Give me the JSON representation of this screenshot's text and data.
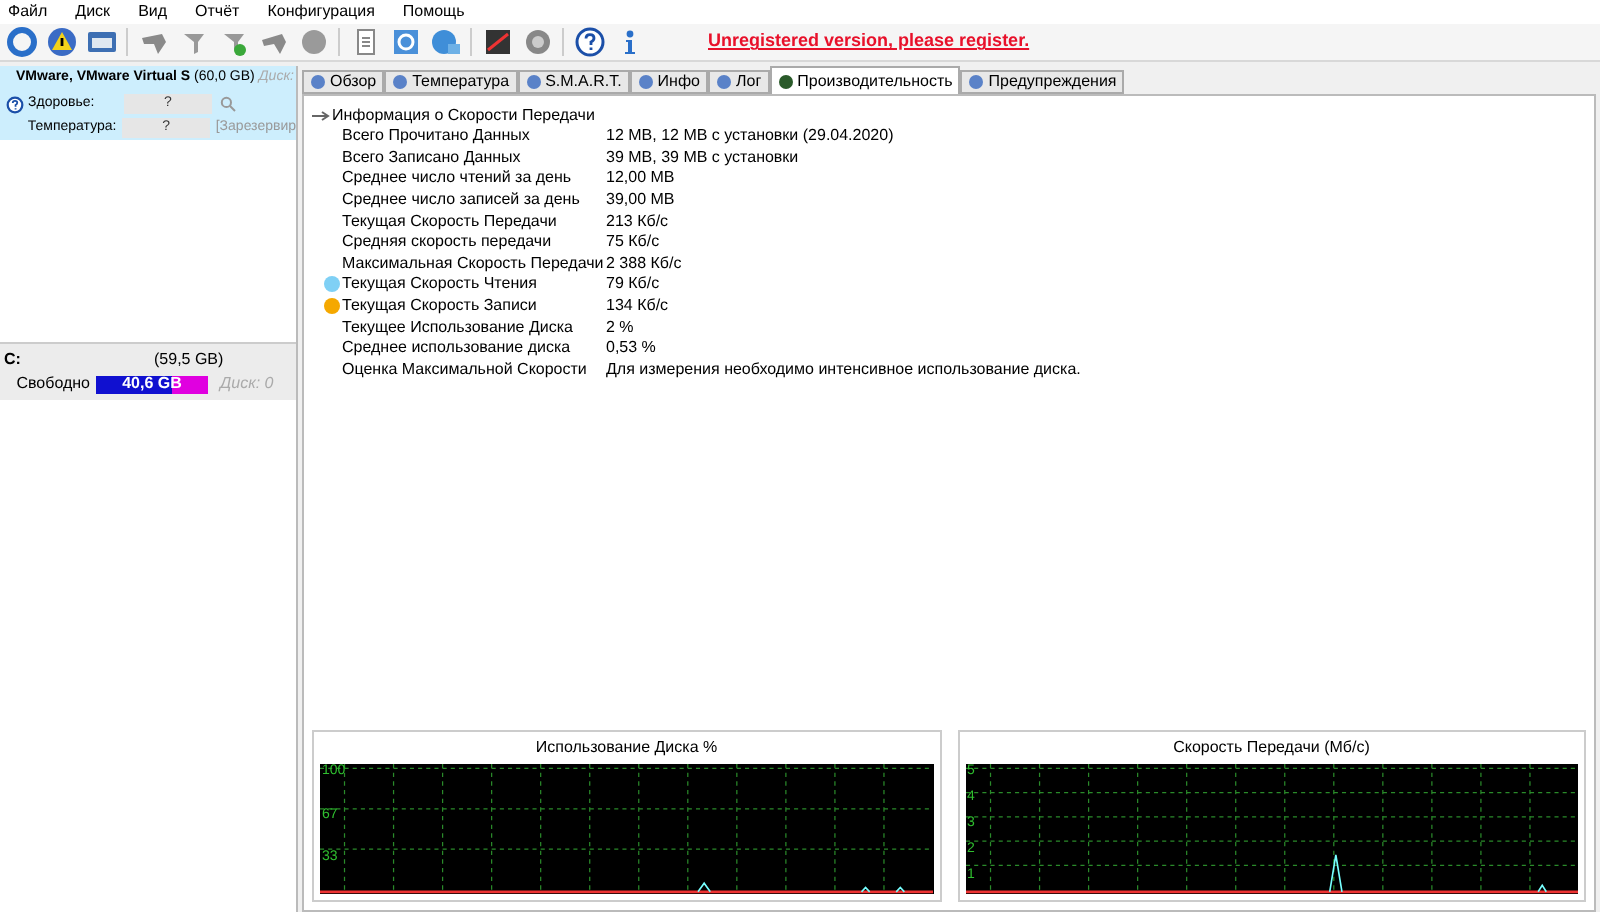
{
  "menu": [
    "Файл",
    "Диск",
    "Вид",
    "Отчёт",
    "Конфигурация",
    "Помощь"
  ],
  "register_link": "Unregistered version, please register.",
  "disk": {
    "title": "VMware, VMware Virtual S",
    "size": "(60,0 GB)",
    "disk_label": "Диск:",
    "selected": true,
    "rows": [
      {
        "label": "Здоровье:",
        "value": "?",
        "extra": "",
        "kind": "health"
      },
      {
        "label": "Температура:",
        "value": "?",
        "extra": "[Зарезервир",
        "kind": "temp"
      }
    ]
  },
  "partition": {
    "name": "C:",
    "size": "(59,5 GB)",
    "free_label": "Свободно",
    "free": "40,6 GB",
    "level": 0.68,
    "disk": "Диск: 0"
  },
  "tabs": [
    {
      "label": "Обзор",
      "selected": false
    },
    {
      "label": "Температура",
      "selected": false
    },
    {
      "label": "S.M.A.R.T.",
      "selected": false
    },
    {
      "label": "Инфо",
      "selected": false
    },
    {
      "label": "Лог",
      "selected": false
    },
    {
      "label": "Производительность",
      "selected": true
    },
    {
      "label": "Предупреждения",
      "selected": false
    }
  ],
  "info": {
    "title": "Информация о Скорости Передачи",
    "expanded": true,
    "rows": [
      {
        "label": "Всего Прочитано Данных",
        "value": "12 MB,  12 MB с установки  (29.04.2020)"
      },
      {
        "label": "Всего Записано Данных",
        "value": "39 MB,  39 MB с установки"
      },
      {
        "label": "Среднее число чтений за день",
        "value": "12,00 MB"
      },
      {
        "label": "Среднее число записей за день",
        "value": "39,00 MB"
      },
      {
        "label": "Текущая Скорость Передачи",
        "value": "213 Кб/с"
      },
      {
        "label": "Средняя скорость передачи",
        "value": "75 Кб/с"
      },
      {
        "label": "Максимальная Скорость Передачи",
        "value": "2 388 Кб/с"
      },
      {
        "label": "Текущая Скорость Чтения",
        "value": "79 Кб/с",
        "color": "#7fd0f5"
      },
      {
        "label": "Текущая Скорость Записи",
        "value": "134 Кб/с",
        "color": "#f5a800"
      },
      {
        "label": "Текущее Использование Диска",
        "value": "2 %"
      },
      {
        "label": "Среднее использование диска",
        "value": "0,53 %"
      },
      {
        "label": "Оценка Максимальной Скорости",
        "value": "Для измерения необходимо интенсивное использование диска."
      }
    ]
  },
  "graphs": [
    {
      "title": "Использование Диска %",
      "tick_labels": [
        "100",
        "67",
        "33"
      ]
    },
    {
      "title": "Скорость Передачи (Мб/с)",
      "tick_labels": [
        "5",
        "4",
        "3",
        "2",
        "1"
      ]
    }
  ]
}
